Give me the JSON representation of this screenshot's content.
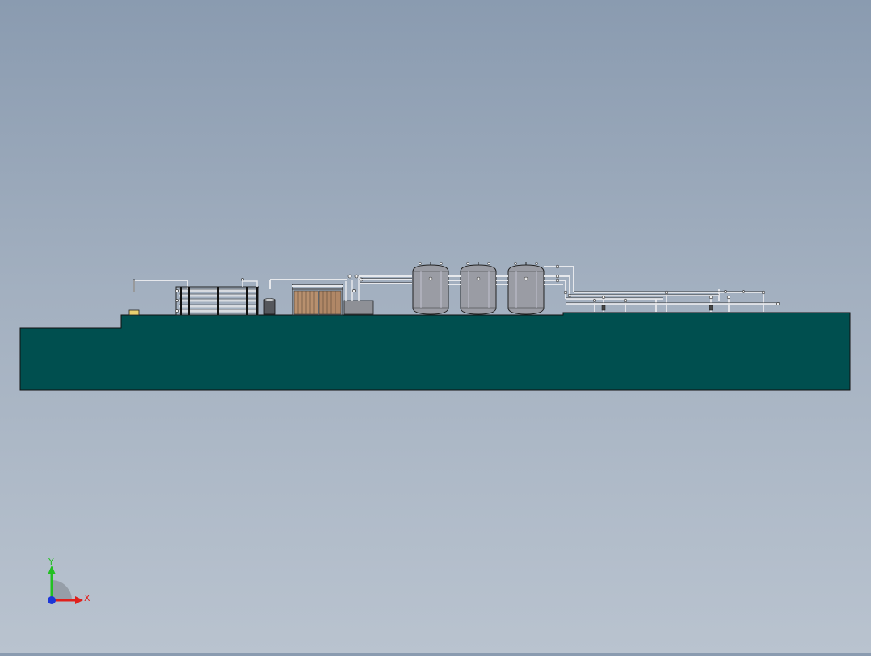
{
  "view": {
    "background_top": "#8a9bb0",
    "background_bottom": "#b9c3cf",
    "slab_color": "#004f4f",
    "tank_color": "#9a9ca4",
    "cartridge_color": "#b8906e",
    "pipe_color": "#e6e8ec",
    "outline_color": "#1a1a1a"
  },
  "triad": {
    "x_label": "X",
    "y_label": "Y",
    "x_color": "#e0201c",
    "y_color": "#22c022",
    "z_color": "#1c36d8"
  }
}
